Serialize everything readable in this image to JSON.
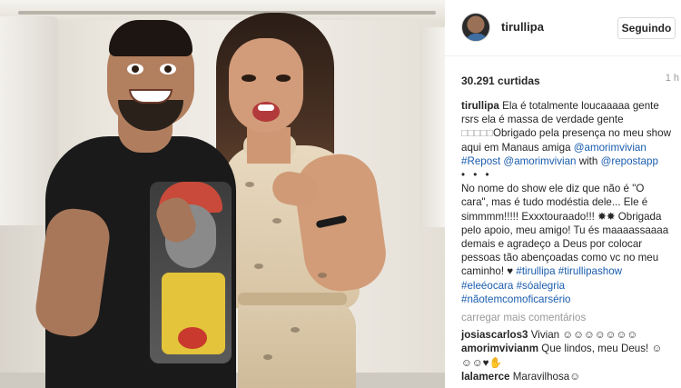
{
  "post": {
    "username": "tirullipa",
    "follow_label": "Seguindo",
    "likes": "30.291 curtidas",
    "time": "1 h"
  },
  "caption": {
    "username": "tirullipa",
    "line1": "Ela é totalmente loucaaaaa gente rsrs ela é massa de verdade gente ",
    "boxes": "□□□□□",
    "line2": "Obrigado pela presença no meu show aqui em Manaus amiga ",
    "mention_amorim": "@amorimvivian",
    "repost_tag": "#Repost",
    "mention_amorim2": "@amorimvivian",
    "with_text": "with ",
    "mention_repostapp": "@repostapp",
    "separator": "• • •",
    "para2": "No nome do show ele diz que não é \"O cara\", mas é tudo modéstia dele... Ele é simmmm!!!!! Exxxtouraado!!! ✸✸ Obrigada pelo apoio, meu amigo! Tu és maaaassaaaa demais e agradeço a Deus por colocar pessoas tão abençoadas como vc no meu caminho! ♥ ",
    "tags": [
      "#tirullipa",
      "#tirullipashow",
      "#eleéocara",
      "#sóalegria",
      "#nãotemcomoficarsério"
    ]
  },
  "load_more_label": "carregar mais comentários",
  "comments": [
    {
      "username": "josiascarlos3",
      "text": "Vivian ☺☺☺☺☺☺☺"
    },
    {
      "username": "amorimvivianm",
      "text": "Que lindos, meu Deus! ☺☺☺♥✋"
    },
    {
      "username": "lalamerce",
      "text": "Maravilhosa☺"
    }
  ]
}
